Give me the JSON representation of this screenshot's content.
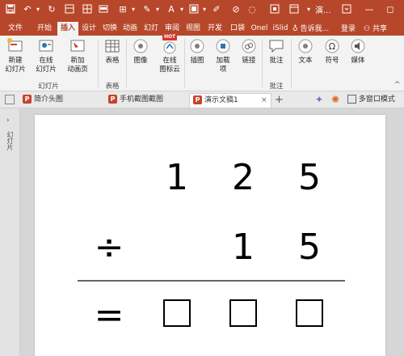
{
  "title_bar": {
    "title": "演...",
    "colors": {
      "brand": "#b7472a"
    },
    "icons": [
      "save-icon",
      "undo-icon",
      "redo-icon",
      "repeat-icon",
      "grid-icon",
      "layout-icon",
      "format-icon",
      "style-icon",
      "text-icon",
      "view-icon",
      "draw-icon",
      "help-icon",
      "restore-icon",
      "window-icon"
    ],
    "window_controls": {
      "minimize": "—",
      "restore": "◻"
    }
  },
  "ribbon_tabs": {
    "items": [
      "文件",
      "开始",
      "插入",
      "设计",
      "切换",
      "动画",
      "幻灯",
      "审阅",
      "视图",
      "开发",
      "口袋",
      "Onel",
      "iSlid"
    ],
    "active": "插入",
    "tell_me": "告诉我...",
    "signin": "登录",
    "share": "共享"
  },
  "ribbon": {
    "new_slide": "新建\n幻灯片",
    "online_slide": "在线\n幻灯片",
    "new_animation_page": "新加\n动画页",
    "group_slides": "幻灯片",
    "table": "表格",
    "group_tables": "表格",
    "image": "图像",
    "online_icon_cloud": "在线\n图标云",
    "hot_badge": "HOT",
    "illustrations": "插图",
    "addins": "加载\n项",
    "link": "链接",
    "comment": "批注",
    "group_comments": "批注",
    "text": "文本",
    "symbol": "符号",
    "media": "媒体"
  },
  "doc_tabs": {
    "items": [
      "简介头图",
      "手机截图截图",
      "演示文稿1"
    ],
    "active": "演示文稿1",
    "new_tab": "+",
    "multi_window": "多窗口模式"
  },
  "left_panel": {
    "label": "幻灯片"
  },
  "slide": {
    "dividend": [
      "1",
      "2",
      "5"
    ],
    "operator": "÷",
    "divisor": [
      "1",
      "5"
    ],
    "equals": "=",
    "answer_boxes": 3
  }
}
